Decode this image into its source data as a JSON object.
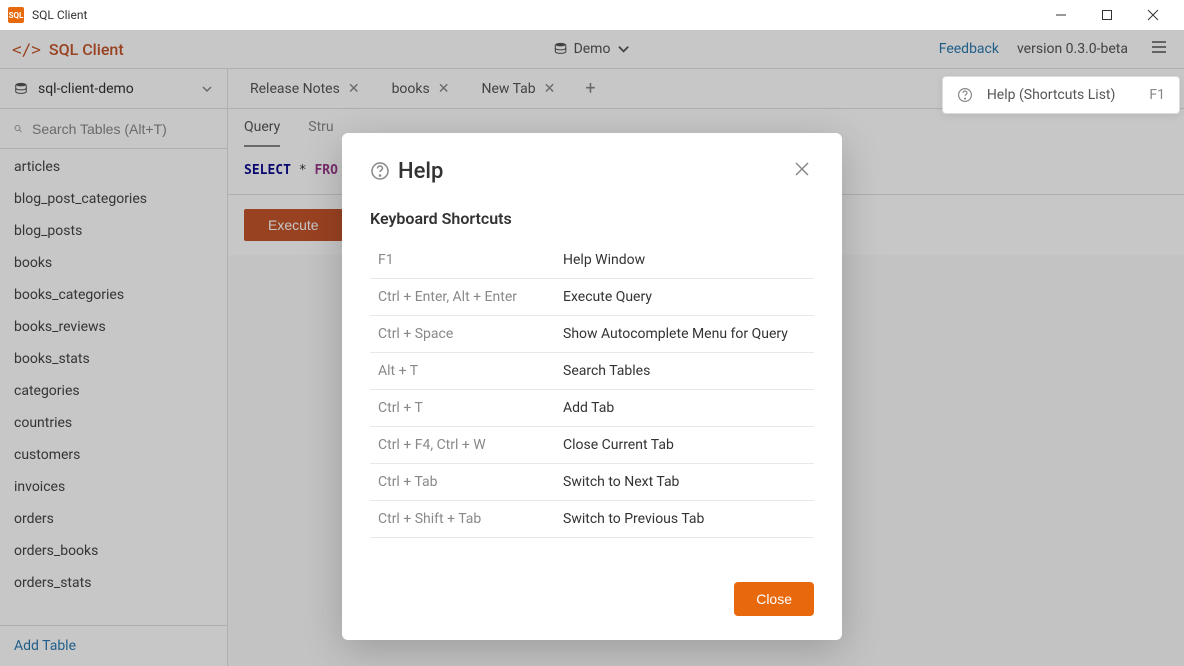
{
  "window": {
    "title": "SQL Client"
  },
  "header": {
    "appName": "SQL Client",
    "dbDropdown": "Demo",
    "feedback": "Feedback",
    "version": "version 0.3.0-beta"
  },
  "sidebar": {
    "dbName": "sql-client-demo",
    "searchPlaceholder": "Search Tables (Alt+T)",
    "tables": [
      "articles",
      "blog_post_categories",
      "blog_posts",
      "books",
      "books_categories",
      "books_reviews",
      "books_stats",
      "categories",
      "countries",
      "customers",
      "invoices",
      "orders",
      "orders_books",
      "orders_stats"
    ],
    "addTable": "Add Table"
  },
  "tabs": {
    "items": [
      {
        "label": "Release Notes",
        "closable": true
      },
      {
        "label": "books",
        "closable": true
      },
      {
        "label": "New Tab",
        "closable": true
      }
    ],
    "subTabs": {
      "query": "Query",
      "structure": "Stru"
    }
  },
  "query": {
    "select": "SELECT",
    "star": "*",
    "from": "FRO",
    "executeBtn": "Execute"
  },
  "helpBadge": {
    "label": "Help (Shortcuts List)",
    "key": "F1"
  },
  "modal": {
    "title": "Help",
    "sectionTitle": "Keyboard Shortcuts",
    "shortcuts": [
      {
        "key": "F1",
        "desc": "Help Window"
      },
      {
        "key": "Ctrl + Enter, Alt + Enter",
        "desc": "Execute Query"
      },
      {
        "key": "Ctrl + Space",
        "desc": "Show Autocomplete Menu for Query"
      },
      {
        "key": "Alt + T",
        "desc": "Search Tables"
      },
      {
        "key": "Ctrl + T",
        "desc": "Add Tab"
      },
      {
        "key": "Ctrl + F4, Ctrl + W",
        "desc": "Close Current Tab"
      },
      {
        "key": "Ctrl + Tab",
        "desc": "Switch to Next Tab"
      },
      {
        "key": "Ctrl + Shift + Tab",
        "desc": "Switch to Previous Tab"
      }
    ],
    "closeBtn": "Close"
  }
}
